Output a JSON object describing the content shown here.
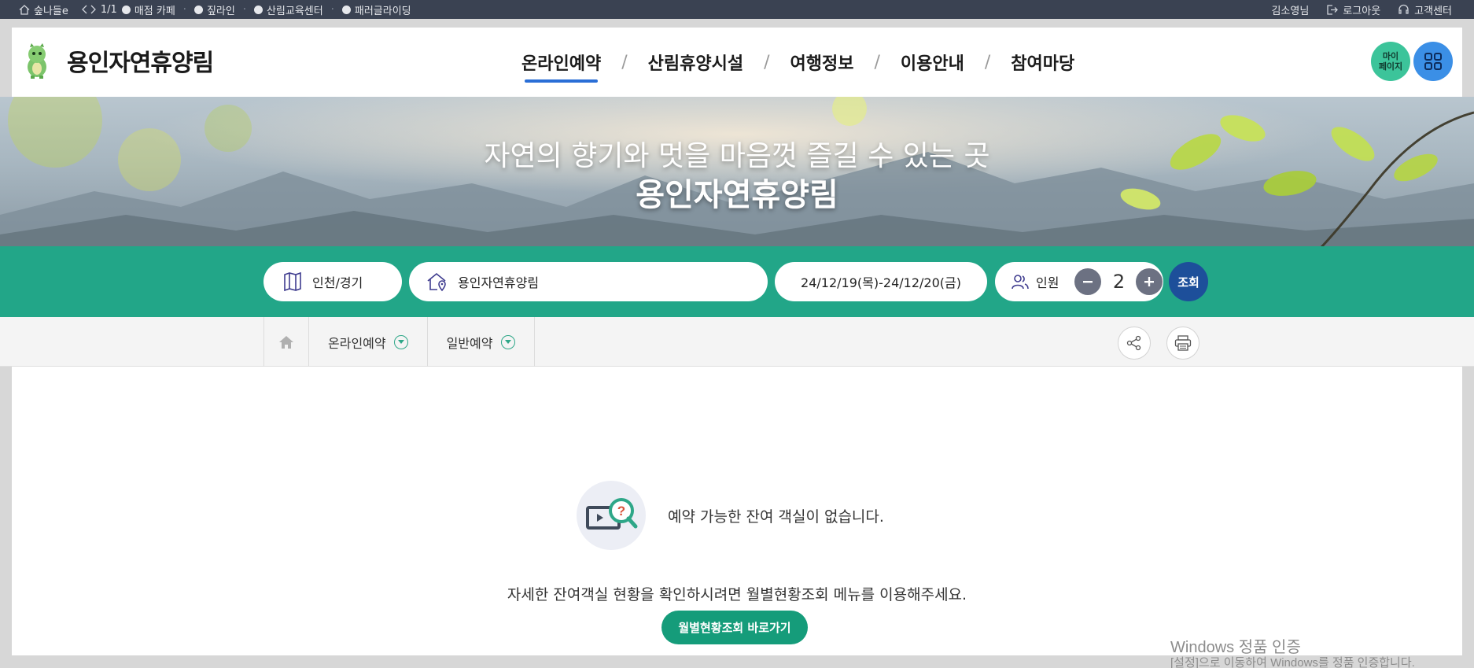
{
  "topbar": {
    "items": [
      {
        "label": "숲나들e",
        "icon": "home-icon"
      },
      {
        "label": "1/1",
        "icon": "prev-next-icon"
      },
      {
        "label": "매점 카페"
      },
      {
        "label": "짚라인"
      },
      {
        "label": "산림교육센터"
      },
      {
        "label": "패러글라이딩"
      }
    ],
    "user_name": "김소영님",
    "logout_label": "로그아웃",
    "support_label": "고객센터"
  },
  "header": {
    "logo_title": "용인자연휴양림",
    "nav": [
      {
        "label": "온라인예약",
        "active": true
      },
      {
        "label": "산림휴양시설",
        "active": false
      },
      {
        "label": "여행정보",
        "active": false
      },
      {
        "label": "이용안내",
        "active": false
      },
      {
        "label": "참여마당",
        "active": false
      }
    ],
    "nav_separator": "/",
    "mypage_label_1": "마이",
    "mypage_label_2": "페이지"
  },
  "hero": {
    "subtitle": "자연의 향기와 멋을 마음껏 즐길 수 있는 곳",
    "title": "용인자연휴양림"
  },
  "search": {
    "region": "인천/경기",
    "place": "용인자연휴양림",
    "date_range": "24/12/19(목)-24/12/20(금)",
    "people_label": "인원",
    "people_count": "2",
    "search_label": "조회"
  },
  "breadcrumb": {
    "items": [
      "온라인예약",
      "일반예약"
    ]
  },
  "content": {
    "no_result_message": "예약 가능한 잔여 객실이 없습니다.",
    "guide_message": "자세한 잔여객실 현황을 확인하시려면 월별현황조회 메뉴를 이용해주세요.",
    "go_button_label": "월별현황조회 바로가기"
  },
  "watermark": {
    "line1": "Windows 정품 인증",
    "line2": "[설정]으로 이동하여 Windows를 정품 인증합니다."
  },
  "colors": {
    "topbar_bg": "#3a4252",
    "search_bar_bg": "#22a688",
    "search_button": "#1d4f9a",
    "mypage": "#3cc49a",
    "menu_button": "#3b8fe6",
    "nav_active_underline": "#2a6ed6",
    "go_button": "#159c7a"
  }
}
